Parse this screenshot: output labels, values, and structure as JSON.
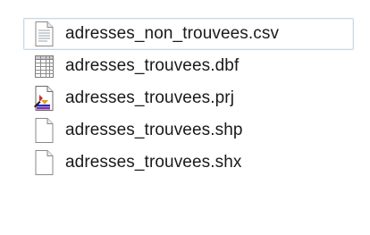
{
  "explorer": {
    "files": [
      {
        "name": "adresses_non_trouvees.csv",
        "icon": "csv-file-icon",
        "selected": true
      },
      {
        "name": "adresses_trouvees.dbf",
        "icon": "dbf-table-file-icon",
        "selected": false
      },
      {
        "name": "adresses_trouvees.prj",
        "icon": "prj-file-icon",
        "selected": false
      },
      {
        "name": "adresses_trouvees.shp",
        "icon": "generic-file-icon",
        "selected": false
      },
      {
        "name": "adresses_trouvees.shx",
        "icon": "generic-file-icon",
        "selected": false
      }
    ]
  }
}
